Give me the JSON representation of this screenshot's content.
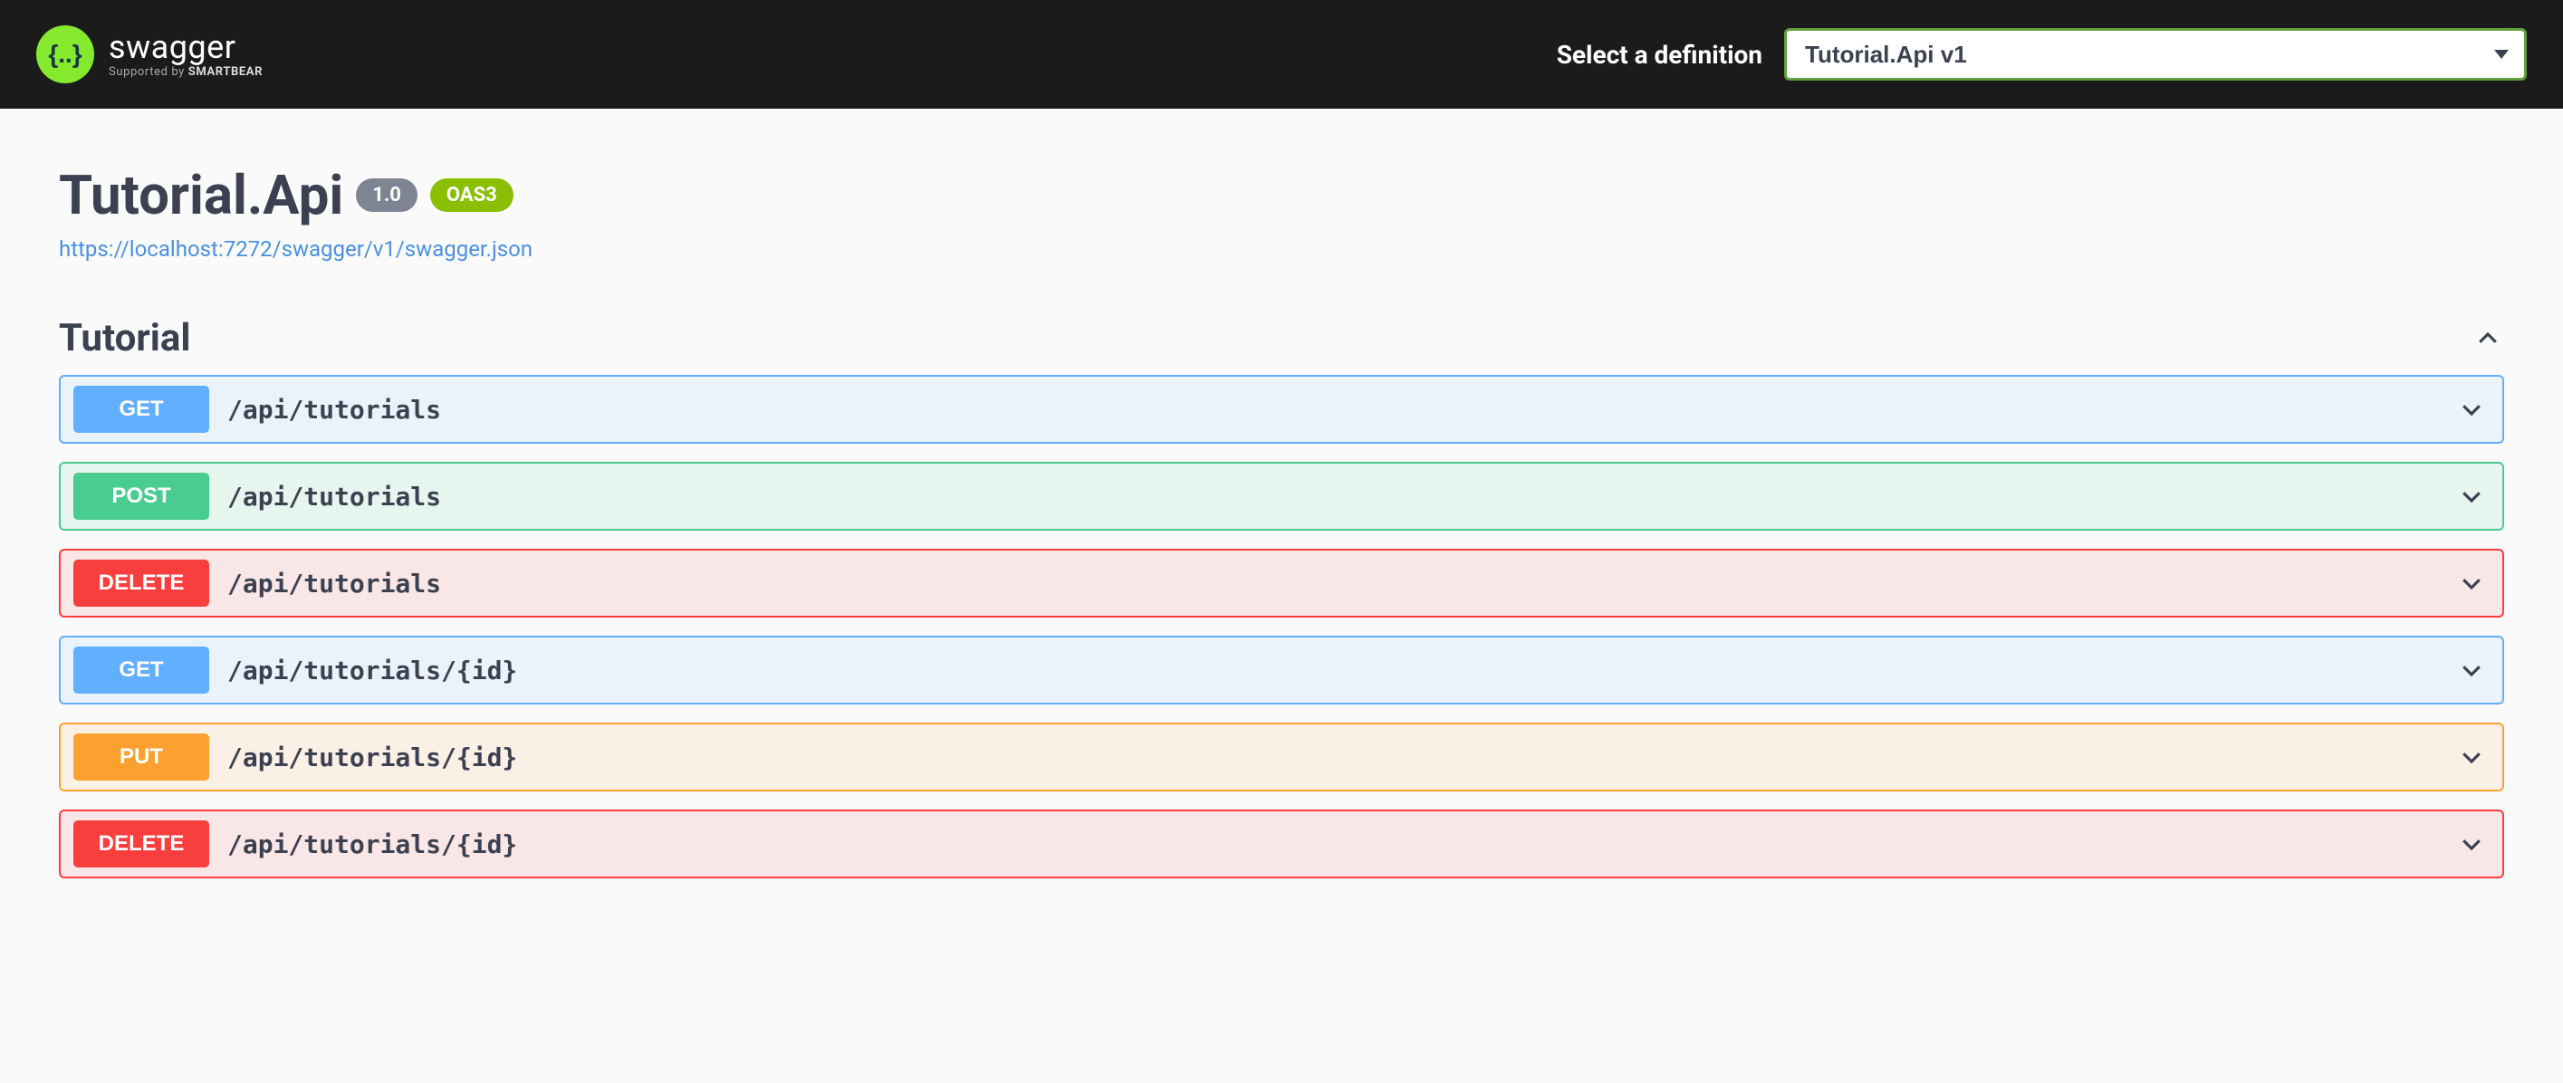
{
  "topbar": {
    "logo_text": "swagger",
    "logo_sub_prefix": "Supported by ",
    "logo_sub_brand": "SMARTBEAR",
    "definition_label": "Select a definition",
    "definition_value": "Tutorial.Api v1"
  },
  "info": {
    "title": "Tutorial.Api",
    "version": "1.0",
    "oas": "OAS3",
    "spec_url": "https://localhost:7272/swagger/v1/swagger.json"
  },
  "tag": {
    "name": "Tutorial"
  },
  "operations": [
    {
      "method": "GET",
      "method_class": "get",
      "path": "/api/tutorials"
    },
    {
      "method": "POST",
      "method_class": "post",
      "path": "/api/tutorials"
    },
    {
      "method": "DELETE",
      "method_class": "delete",
      "path": "/api/tutorials"
    },
    {
      "method": "GET",
      "method_class": "get",
      "path": "/api/tutorials/{id}"
    },
    {
      "method": "PUT",
      "method_class": "put",
      "path": "/api/tutorials/{id}"
    },
    {
      "method": "DELETE",
      "method_class": "delete",
      "path": "/api/tutorials/{id}"
    }
  ]
}
